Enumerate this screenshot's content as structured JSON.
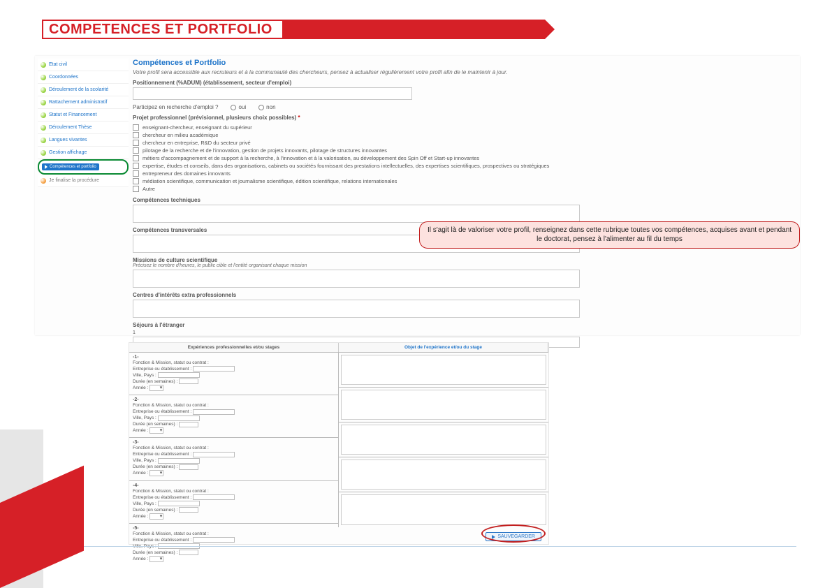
{
  "title": "COMPETENCES ET PORTFOLIO",
  "sidebar": {
    "items": [
      {
        "label": "Etat civil"
      },
      {
        "label": "Coordonnées"
      },
      {
        "label": "Déroulement de la scolarité"
      },
      {
        "label": "Rattachement administratif"
      },
      {
        "label": "Statut et Financement"
      },
      {
        "label": "Déroulement Thèse"
      },
      {
        "label": "Langues vivantes"
      },
      {
        "label": "Gestion affichage"
      },
      {
        "label": "Compétences et portfolio"
      },
      {
        "label": "Je finalise la procédure"
      }
    ],
    "active_index": 8
  },
  "form": {
    "heading": "Compétences et Portfolio",
    "intro": "Votre profil sera accessible aux recruteurs et à la communauté des chercheurs, pensez à actualiser régulièrement votre profil afin de le maintenir à jour.",
    "f1_label": "Positionnement (%ADUM) (établissement, secteur d'emploi)",
    "radio_label": "Participez en recherche d'emploi ?",
    "radio_opts": [
      "oui",
      "non"
    ],
    "projet_label": "Projet professionnel (prévisionnel, plusieurs choix possibles)",
    "projet_opts": [
      "enseignant-chercheur, enseignant du supérieur",
      "chercheur en milieu académique",
      "chercheur en entreprise, R&D du secteur privé",
      "pilotage de la recherche et de l'innovation, gestion de projets innovants, pilotage de structures innovantes",
      "métiers d'accompagnement et de support à la recherche, à l'innovation et à la valorisation, au développement des Spin Off et Start-up innovantes",
      "expertise, études et conseils, dans des organisations, cabinets ou sociétés fournissant des prestations intellectuelles, des expertises scientifiques, prospectives ou stratégiques",
      "entrepreneur des domaines innovants",
      "médiation scientifique, communication et journalisme scientifique, édition scientifique, relations internationales",
      "Autre"
    ],
    "sec_labels": [
      "Compétences techniques",
      "Compétences transversales",
      "Missions de culture scientifique",
      "Précisez le nombre d'heures, le public cible et l'entité organisant chaque mission",
      "Centres d'intérêts extra professionnels",
      "Séjours à l'étranger"
    ],
    "one": "1"
  },
  "callout": "Il s'agit là de valoriser votre profil, renseignez dans cette rubrique toutes vos compétences, acquises avant et pendant le doctorat, pensez à l'alimenter au fil du temps",
  "table2": {
    "left_header": "Expériences professionnelles et/ou stages",
    "right_header": "Objet de l'expérience et/ou du stage",
    "group_title": "Fonction & Mission, statut ou contrat :",
    "lines": {
      "ent": "Entreprise ou établissement :",
      "ville": "Ville, Pays :",
      "duree": "Durée (en semaines) :",
      "annee": "Année :"
    },
    "nums": [
      "-1-",
      "-2-",
      "-3-",
      "-4-",
      "-5-"
    ],
    "save": "SAUVEGARDER"
  }
}
